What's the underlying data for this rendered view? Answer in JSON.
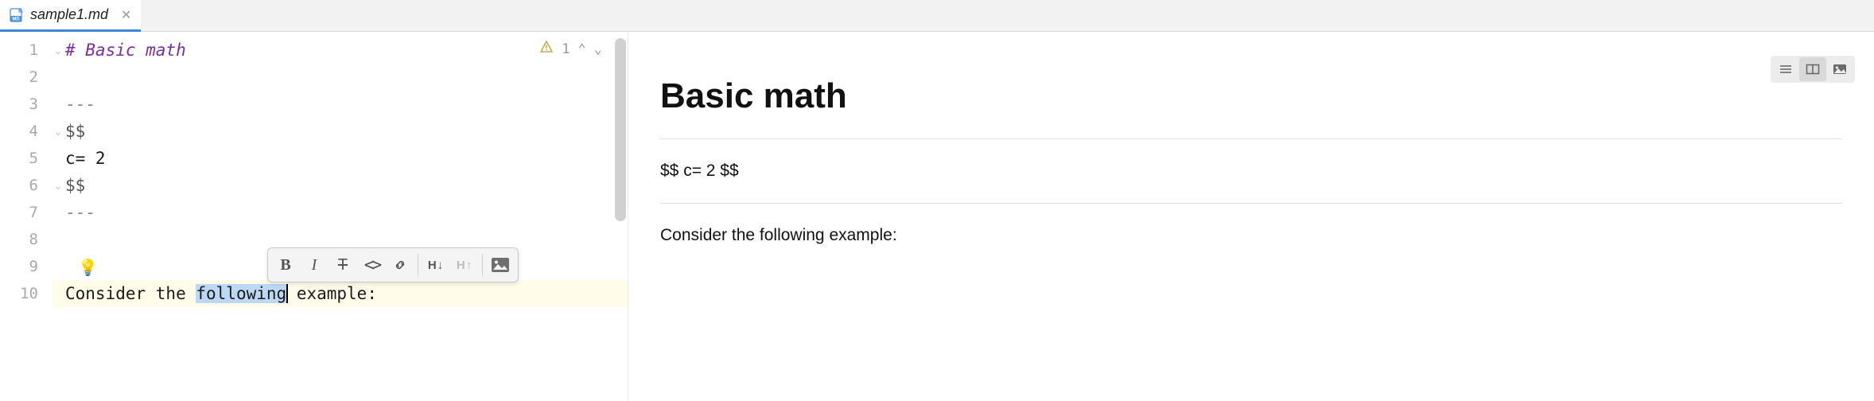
{
  "tab": {
    "filename": "sample1.md",
    "md_badge": "MD"
  },
  "editor": {
    "lines": [
      "1",
      "2",
      "3",
      "4",
      "5",
      "6",
      "7",
      "8",
      "9",
      "10"
    ],
    "content": {
      "l1": "# Basic math",
      "l2": "",
      "l3": "---",
      "l4": "$$",
      "l5": "c= 2",
      "l6": "$$",
      "l7": "---",
      "l8": "",
      "l9": "",
      "l10_pre": "Consider the ",
      "l10_sel": "following",
      "l10_post": " example:"
    },
    "inspection": {
      "count": "1"
    }
  },
  "toolbar": {
    "bold": "B",
    "italic": "I",
    "strike": "T",
    "code": "<>",
    "link_glyph": "🔗",
    "h_down": "H↓",
    "h_up": "H↑"
  },
  "preview": {
    "title": "Basic math",
    "math": "$$ c= 2 $$",
    "paragraph": "Consider the following example:"
  }
}
